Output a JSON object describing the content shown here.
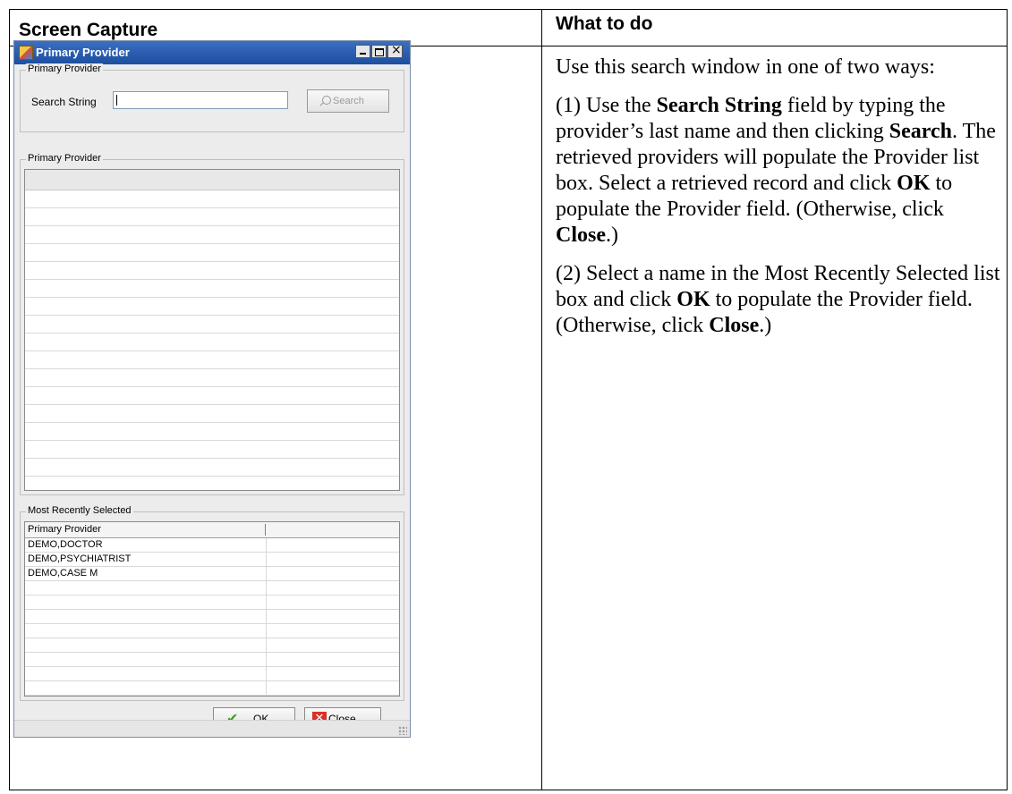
{
  "table": {
    "header_left": "Screen Capture",
    "header_right": "What to do"
  },
  "window": {
    "title": "Primary Provider",
    "search_group_label": "Primary Provider",
    "search_label": "Search String",
    "search_value": "",
    "search_button": "Search",
    "results_group_label": "Primary Provider",
    "recent_group_label": "Most Recently Selected",
    "recent_column": "Primary Provider",
    "recent_rows": [
      "DEMO,DOCTOR",
      "DEMO,PSYCHIATRIST",
      "DEMO,CASE M"
    ],
    "ok_label": "OK",
    "close_label": "Close"
  },
  "instructions": {
    "p1": "Use this search window in one of two ways:",
    "p2_a": "(1) Use the ",
    "p2_b": "Search String",
    "p2_c": " field by typing the provider’s last name and then clicking ",
    "p2_d": "Search",
    "p2_e": ". The retrieved providers will populate the Provider list box. Select a retrieved record and click ",
    "p2_f": "OK",
    "p2_g": " to populate the Provider field. (Otherwise, click ",
    "p2_h": "Close",
    "p2_i": ".)",
    "p3_a": "(2) Select a name in the Most Recently Selected list box and click ",
    "p3_b": "OK",
    "p3_c": " to populate the Provider field. (Otherwise, click ",
    "p3_d": "Close",
    "p3_e": ".)"
  }
}
